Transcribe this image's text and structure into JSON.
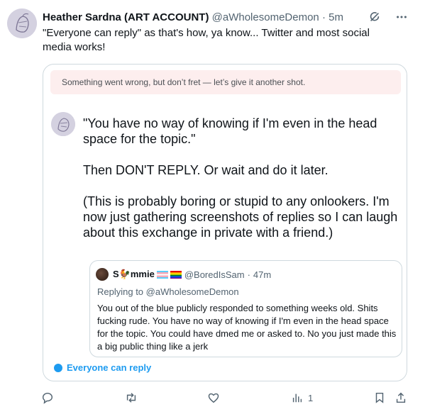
{
  "tweet": {
    "author_name": "Heather Sardna (ART ACCOUNT)",
    "author_handle": "@aWholesomeDemon",
    "separator": "·",
    "time": "5m",
    "text": "\"Everyone can reply\" as that's how, ya know... Twitter and most social media works!"
  },
  "card": {
    "error_message": "Something went wrong, but don’t fret — let’s give it another shot.",
    "paragraphs": [
      "\"You have no way of knowing if I'm even in the head space for the topic.\"",
      "Then DON'T REPLY. Or wait and do it later.",
      "(This is probably boring or stupid to any onlookers. I'm now just gathering screenshots of replies so I can laugh about this exchange in private with a friend.)"
    ],
    "quote": {
      "name": "S🐓mmie",
      "handle": "@BoredIsSam",
      "separator": "·",
      "time": "47m",
      "replying_label": "Replying to @aWholesomeDemon",
      "body": "You out of the blue publicly responded to something weeks old. Shits fucking rude. You have no way of knowing if I'm even in the head space for the topic. You could have dmed me or asked to. No you just made this a big public thing like a jerk"
    },
    "reply_setting": "Everyone can reply"
  },
  "actions": {
    "views_count": "1"
  },
  "icons": {
    "grok": "grok-icon",
    "more": "more-icon",
    "reply": "reply-icon",
    "retweet": "retweet-icon",
    "like": "like-icon",
    "views": "views-icon",
    "bookmark": "bookmark-icon",
    "share": "share-icon"
  },
  "colors": {
    "accent": "#1d9bf0",
    "text": "#0f1419",
    "muted": "#536471",
    "error_bg": "#fdeeee",
    "border": "#cfd9de"
  }
}
